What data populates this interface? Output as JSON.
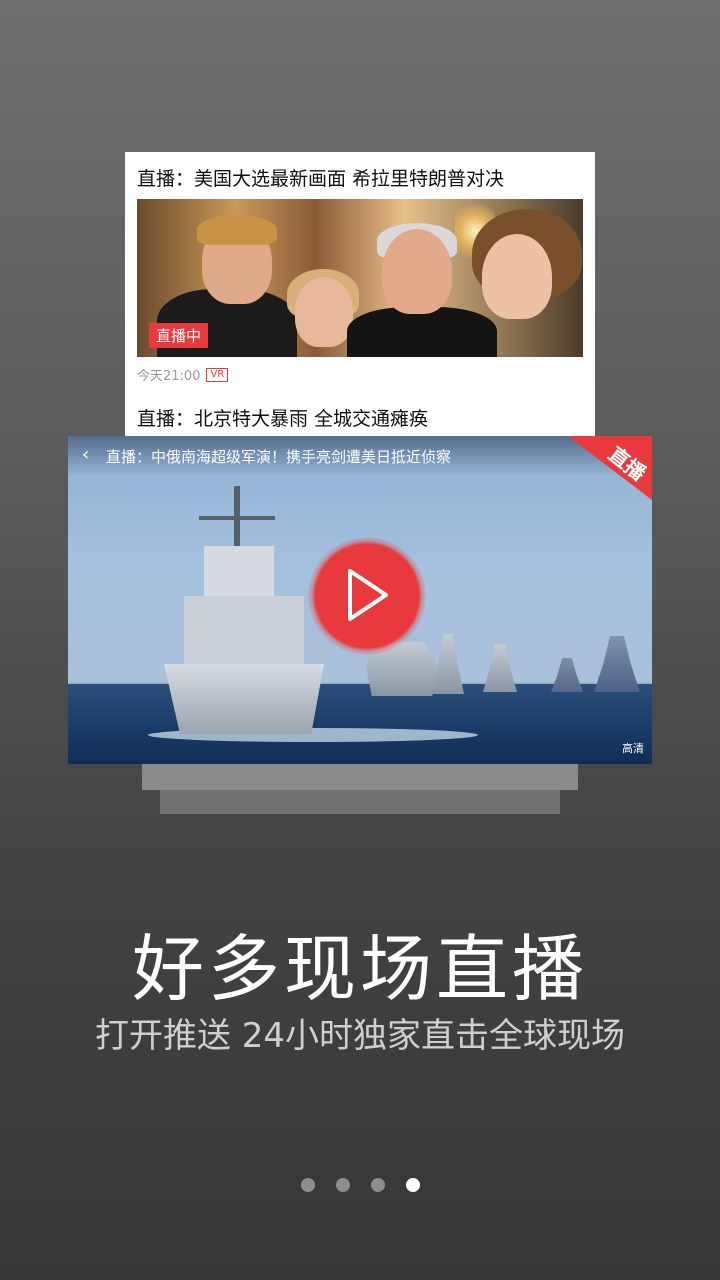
{
  "news_card": {
    "title": "直播：美国大选最新画面 希拉里特朗普对决",
    "live_badge": "直播中",
    "time": "今天21:00",
    "vr_tag": "VR",
    "title2": "直播：北京特大暴雨 全城交通瘫痪"
  },
  "video_card": {
    "back_icon": "‹",
    "title": "直播：中俄南海超级军演！携手亮剑遭美日抵近侦察",
    "corner_label": "直播",
    "hd_label": "高清",
    "icons": {
      "back": "chevron-left-icon",
      "play": "play-icon"
    },
    "accent_color": "#e8393c"
  },
  "headline": "好多现场直播",
  "subline": "打开推送  24小时独家直击全球现场",
  "pagination": {
    "total": 4,
    "active_index": 3
  }
}
